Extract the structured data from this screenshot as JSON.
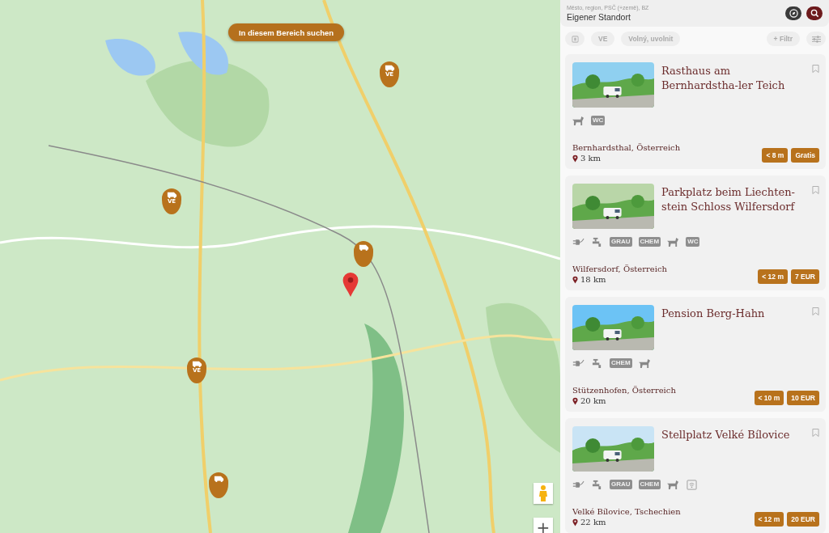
{
  "map": {
    "search_area_button": "In diesem Bereich suchen",
    "markers": [
      {
        "kind": "ve",
        "label": "VE"
      },
      {
        "kind": "ve",
        "label": "VE"
      },
      {
        "kind": "van"
      },
      {
        "kind": "location"
      },
      {
        "kind": "ve",
        "label": "VE"
      },
      {
        "kind": "van"
      }
    ],
    "zoom_in": "+"
  },
  "search": {
    "label": "Město, region, PSČ (+země), BZ",
    "value": "Eigener Standort"
  },
  "filters": [
    {
      "kind": "icon"
    },
    {
      "kind": "chip",
      "label": "VE"
    },
    {
      "kind": "chip",
      "label": "Volný, uvolnit"
    },
    {
      "kind": "add",
      "label": "+ Filtr"
    },
    {
      "kind": "settings"
    }
  ],
  "places": [
    {
      "title": "Rasthaus am Bernhardstha-ler Teich",
      "amenities": [
        {
          "kind": "dog"
        },
        {
          "kind": "text",
          "label": "WC"
        }
      ],
      "location": "Bernhardsthal, Österreich",
      "distance": "3 km",
      "badges": [
        "< 8 m",
        "Gratis"
      ]
    },
    {
      "title": "Parkplatz beim Liechten-stein Schloss Wilfersdorf",
      "amenities": [
        {
          "kind": "power"
        },
        {
          "kind": "water"
        },
        {
          "kind": "text",
          "label": "GRAU"
        },
        {
          "kind": "text",
          "label": "CHEM"
        },
        {
          "kind": "dog"
        },
        {
          "kind": "text",
          "label": "WC"
        }
      ],
      "location": "Wilfersdorf, Österreich",
      "distance": "18 km",
      "badges": [
        "< 12 m",
        "7 EUR"
      ]
    },
    {
      "title": "Pension Berg-Hahn",
      "amenities": [
        {
          "kind": "power"
        },
        {
          "kind": "water"
        },
        {
          "kind": "text",
          "label": "CHEM"
        },
        {
          "kind": "dog"
        }
      ],
      "location": "Stützenhofen, Österreich",
      "distance": "20 km",
      "badges": [
        "< 10 m",
        "10 EUR"
      ]
    },
    {
      "title": "Stellplatz Velké Bílovice",
      "amenities": [
        {
          "kind": "power"
        },
        {
          "kind": "water"
        },
        {
          "kind": "text",
          "label": "GRAU"
        },
        {
          "kind": "text",
          "label": "CHEM"
        },
        {
          "kind": "dog"
        },
        {
          "kind": "wifi"
        }
      ],
      "location": "Velké Bílovice, Tschechien",
      "distance": "22 km",
      "badges": [
        "< 12 m",
        "20 EUR"
      ]
    }
  ]
}
